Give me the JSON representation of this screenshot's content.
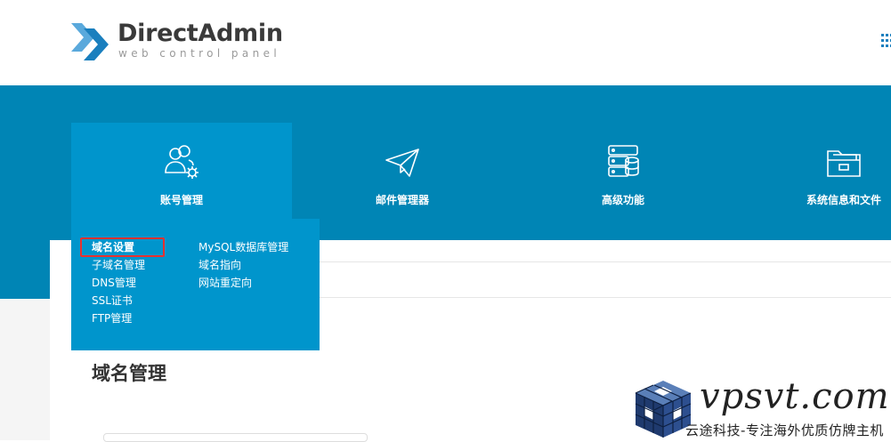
{
  "header": {
    "logo_title": "DirectAdmin",
    "logo_subtitle": "web control panel",
    "apps_icon": "grid-icon"
  },
  "nav": {
    "items": [
      {
        "label": "账号管理",
        "icon": "users-gear-icon",
        "active": true
      },
      {
        "label": "邮件管理器",
        "icon": "paper-plane-icon",
        "active": false
      },
      {
        "label": "高级功能",
        "icon": "server-database-icon",
        "active": false
      },
      {
        "label": "系统信息和文件",
        "icon": "folder-icon",
        "active": false
      }
    ]
  },
  "dropdown": {
    "col1": [
      "域名设置",
      "子域名管理",
      "DNS管理",
      "SSL证书",
      "FTP管理"
    ],
    "col2": [
      "MySQL数据库管理",
      "域名指向",
      "网站重定向"
    ],
    "highlighted": "域名设置"
  },
  "page": {
    "title": "域名管理"
  },
  "watermark": {
    "domain": "vpsvt.com",
    "tagline": "云途科技-专注海外优质仿牌主机"
  },
  "colors": {
    "band": "#0085b5",
    "active_nav": "#0095cc",
    "highlight_border": "#e8312f",
    "logo_blue": "#1a7fbe"
  }
}
